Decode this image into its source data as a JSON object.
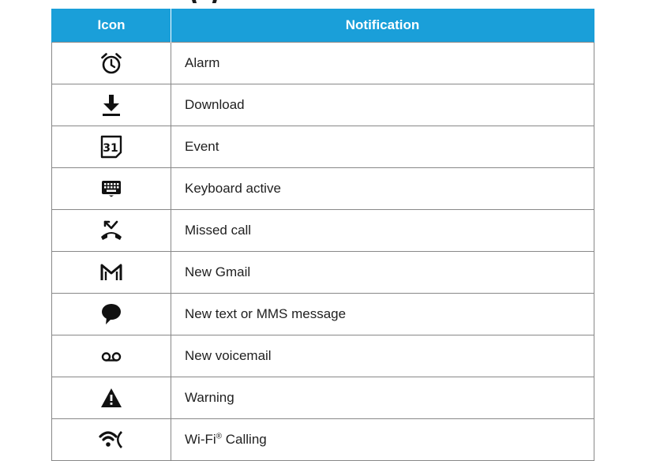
{
  "table": {
    "headers": {
      "icon": "Icon",
      "notification": "Notification"
    },
    "header_color": "#1a9fd9",
    "rows": [
      {
        "icon": "alarm-icon",
        "label": "Alarm"
      },
      {
        "icon": "download-icon",
        "label": "Download"
      },
      {
        "icon": "calendar-event-icon",
        "label": "Event"
      },
      {
        "icon": "keyboard-icon",
        "label": "Keyboard active"
      },
      {
        "icon": "missed-call-icon",
        "label": "Missed call"
      },
      {
        "icon": "gmail-icon",
        "label": "New Gmail"
      },
      {
        "icon": "message-icon",
        "label": "New text or MMS message"
      },
      {
        "icon": "voicemail-icon",
        "label": "New voicemail"
      },
      {
        "icon": "warning-icon",
        "label": "Warning"
      },
      {
        "icon": "wifi-calling-icon",
        "label": "Wi-Fi",
        "label_mark": "®",
        "label_suffix": " Calling"
      }
    ],
    "calendar_day": "31"
  }
}
